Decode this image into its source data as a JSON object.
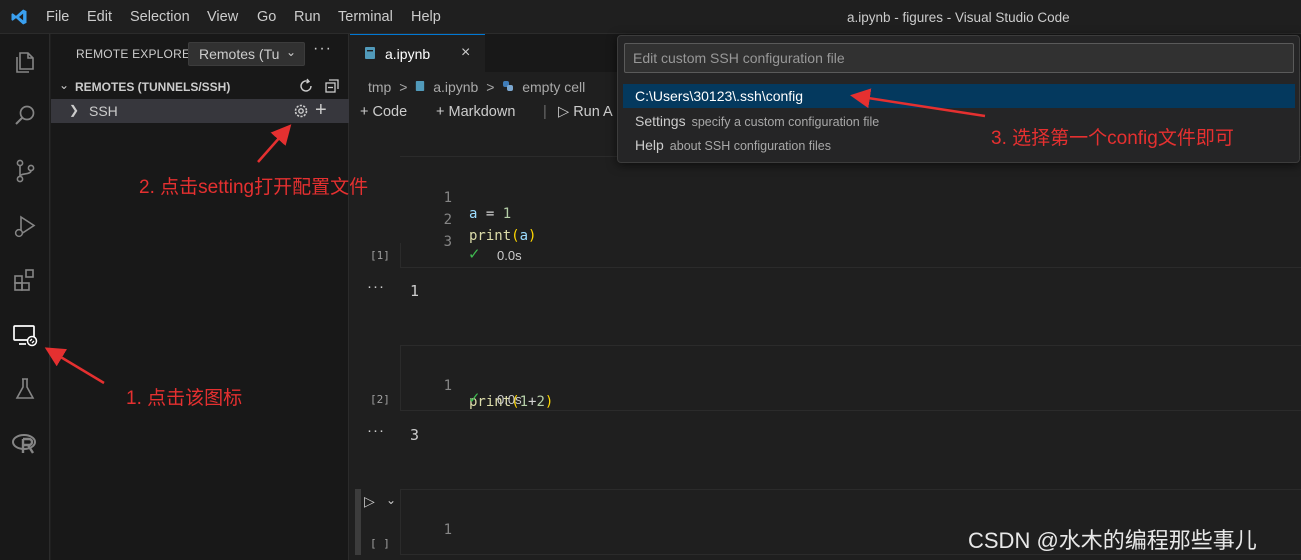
{
  "app": {
    "menu": [
      "File",
      "Edit",
      "Selection",
      "View",
      "Go",
      "Run",
      "Terminal",
      "Help"
    ],
    "window_title": "a.ipynb - figures - Visual Studio Code"
  },
  "sidebar": {
    "title": "REMOTE EXPLORER",
    "dropdown_value": "Remotes (Tu",
    "section_label": "REMOTES (TUNNELS/SSH)",
    "items": [
      {
        "label": "SSH"
      }
    ]
  },
  "editor": {
    "tab": {
      "name": "a.ipynb",
      "close": "×"
    },
    "breadcrumb": [
      "tmp",
      ">",
      "a.ipynb",
      ">",
      "empty cell"
    ],
    "toolbar": {
      "code": "Code",
      "markdown": "Markdown",
      "run_all": "Run A"
    },
    "cells": [
      {
        "exec_count": "[1]",
        "lines": [
          {
            "num": "1",
            "text": "a = 1"
          },
          {
            "num": "2",
            "text": "print(a)"
          },
          {
            "num": "3",
            "text": ""
          }
        ],
        "duration": "0.0s",
        "output": "1"
      },
      {
        "exec_count": "[2]",
        "lines": [
          {
            "num": "1",
            "text": "print(1+2)"
          }
        ],
        "duration": "0.0s",
        "output": "3"
      },
      {
        "exec_count": "[ ]",
        "lines": [
          {
            "num": "1",
            "text": ""
          }
        ]
      }
    ]
  },
  "quick_pick": {
    "placeholder": "Edit custom SSH configuration file",
    "items": [
      {
        "label": "C:\\Users\\30123\\.ssh\\config",
        "description": ""
      },
      {
        "label": "Settings",
        "description": "specify a custom configuration file"
      },
      {
        "label": "Help",
        "description": "about SSH configuration files"
      }
    ]
  },
  "annotations": {
    "step1": "1. 点击该图标",
    "step2": "2. 点击setting打开配置文件",
    "step3": "3. 选择第一个config文件即可"
  },
  "watermark": "CSDN @水木的编程那些事儿",
  "colors": {
    "accent": "#0078d4",
    "annotation": "#e53030",
    "selection": "#04395e",
    "success": "#3fb950"
  }
}
